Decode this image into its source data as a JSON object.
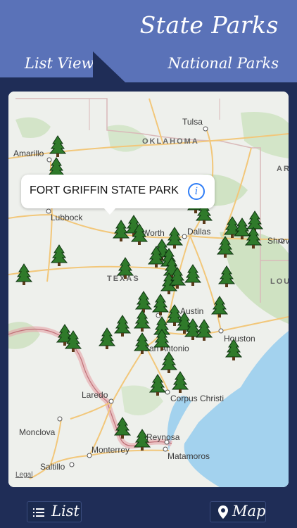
{
  "header": {
    "title": "State Parks",
    "tab_list": "List View",
    "tab_national": "National Parks"
  },
  "map": {
    "states": [
      "OKLAHOMA",
      "TEXAS",
      "AR",
      "LOU"
    ],
    "cities": [
      "Tulsa",
      "Amarillo",
      "Lubbock",
      "Worth",
      "Dallas",
      "Shrev",
      "Austin",
      "Houston",
      "San Antonio",
      "Laredo",
      "Corpus Christi",
      "Monclova",
      "Reynosa",
      "Monterrey",
      "Matamoros",
      "Saltillo"
    ],
    "legal": "Legal",
    "park_marker_count": 44
  },
  "callout": {
    "park_name": "FORT GRIFFIN STATE PARK",
    "info_icon": "info-icon"
  },
  "footer": {
    "list_label": "List",
    "map_label": "Map"
  }
}
